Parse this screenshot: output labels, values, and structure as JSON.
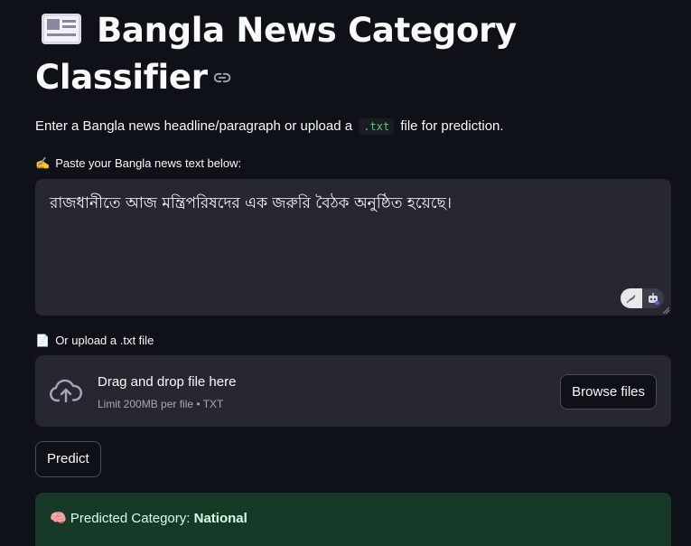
{
  "header": {
    "title": "Bangla News Category Classifier",
    "title_icon": "newspaper-emoji",
    "anchor_icon": "link-icon"
  },
  "intro": {
    "text_before": "Enter a Bangla news headline/paragraph or upload a",
    "code": ".txt",
    "text_after": "file for prediction."
  },
  "text_input": {
    "label_icon": "✍️",
    "label": "Paste your Bangla news text below:",
    "value": "রাজধানীতে আজ মন্ত্রিপরিষদের এক জরুরি বৈঠক অনুষ্ঠিত হয়েছে।"
  },
  "uploader": {
    "label_icon": "📄",
    "label": "Or upload a .txt file",
    "drag_text": "Drag and drop file here",
    "limit_text": "Limit 200MB per file • TXT",
    "browse_label": "Browse files",
    "icon": "cloud-upload-icon"
  },
  "predict": {
    "label": "Predict"
  },
  "result": {
    "icon": "🧠",
    "prefix": "Predicted Category:",
    "category": "National"
  },
  "colors": {
    "background": "#0e1117",
    "input_bg": "#262730",
    "success_bg": "#173928",
    "code_green": "#3dd56d"
  }
}
